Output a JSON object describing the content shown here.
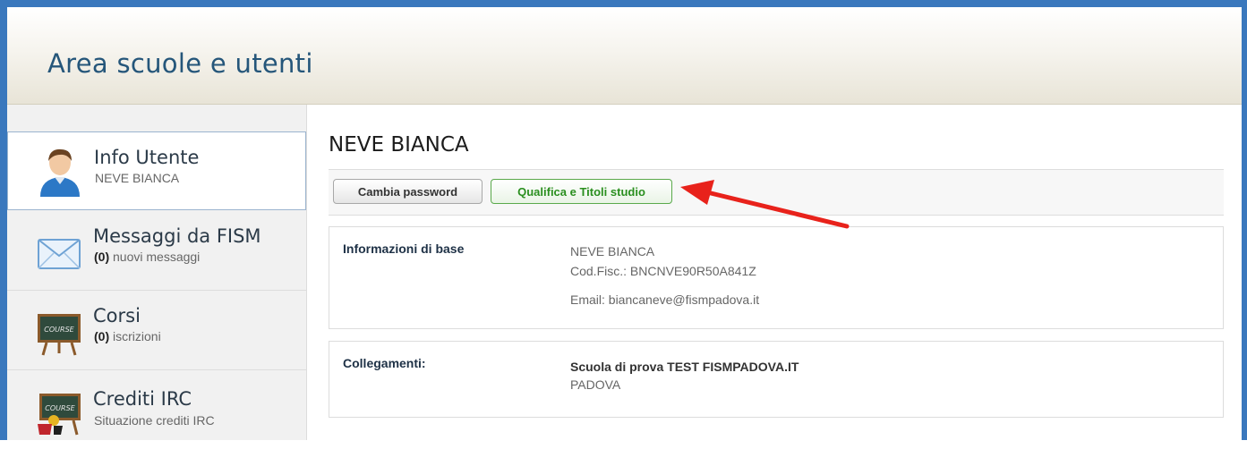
{
  "header": {
    "title": "Area scuole e utenti"
  },
  "sidebar": {
    "items": [
      {
        "title": "Info Utente",
        "sub": "NEVE BIANCA",
        "icon": "user-icon"
      },
      {
        "title": "Messaggi da FISM",
        "count": "(0)",
        "sub": " nuovi messaggi",
        "icon": "envelope-icon"
      },
      {
        "title": "Corsi",
        "count": "(0)",
        "sub": " iscrizioni",
        "icon": "course-board-icon"
      },
      {
        "title": "Crediti IRC",
        "sub": "Situazione crediti IRC",
        "icon": "course-board-award-icon"
      }
    ]
  },
  "main": {
    "title": "NEVE BIANCA",
    "buttons": {
      "change_password": "Cambia password",
      "qualifications": "Qualifica e Titoli studio"
    },
    "basic_info": {
      "label": "Informazioni di base",
      "name": "NEVE BIANCA",
      "fiscal_code": "Cod.Fisc.: BNCNVE90R50A841Z",
      "email": "Email: biancaneve@fismpadova.it"
    },
    "links": {
      "label": "Collegamenti:",
      "school": "Scuola di prova TEST FISMPADOVA.IT",
      "city": "PADOVA"
    }
  },
  "colors": {
    "frame": "#3a78bd",
    "accent_green": "#2a8f1f",
    "arrow": "#e8221b"
  }
}
